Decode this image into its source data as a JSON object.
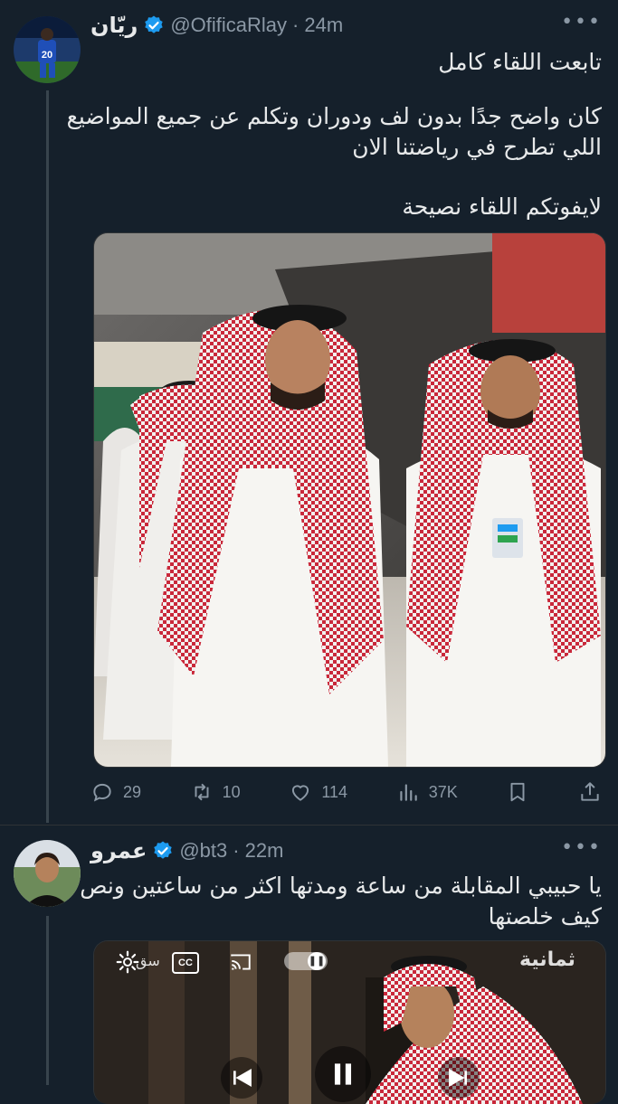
{
  "tweets": [
    {
      "name": "ريّان",
      "handle": "@OfificaRlay",
      "dot": "·",
      "time": "24m",
      "lines": [
        "تابعت اللقاء كامل",
        "كان واضح جدًا بدون لف ودوران وتكلم عن جميع المواضيع",
        "اللي تطرح في رياضتنا الان",
        "لايفوتكم اللقاء نصيحة"
      ],
      "stats": {
        "replies": "29",
        "retweets": "10",
        "likes": "114",
        "views": "37K"
      },
      "jersey_number": "20"
    },
    {
      "name": "عمرو",
      "handle": "@bt3",
      "dot": "·",
      "time": "22m",
      "lines": [
        "يا حبيبي المقابلة من ساعة ومدتها اكثر من ساعتين ونص",
        "كيف خلصتها"
      ],
      "video_logo": "ثمانية",
      "video_settings_label": "سق",
      "cc_label": "CC"
    }
  ],
  "colors": {
    "background": "#15202b",
    "text": "#e7e9ea",
    "muted": "#8b98a5",
    "verified": "#1d9bf0",
    "divider": "#2f3336"
  },
  "icons": {
    "more": "more-icon",
    "reply": "reply-icon",
    "retweet": "retweet-icon",
    "like": "heart-icon",
    "views": "views-icon",
    "bookmark": "bookmark-icon",
    "share": "share-icon",
    "verified": "verified-badge-icon"
  }
}
